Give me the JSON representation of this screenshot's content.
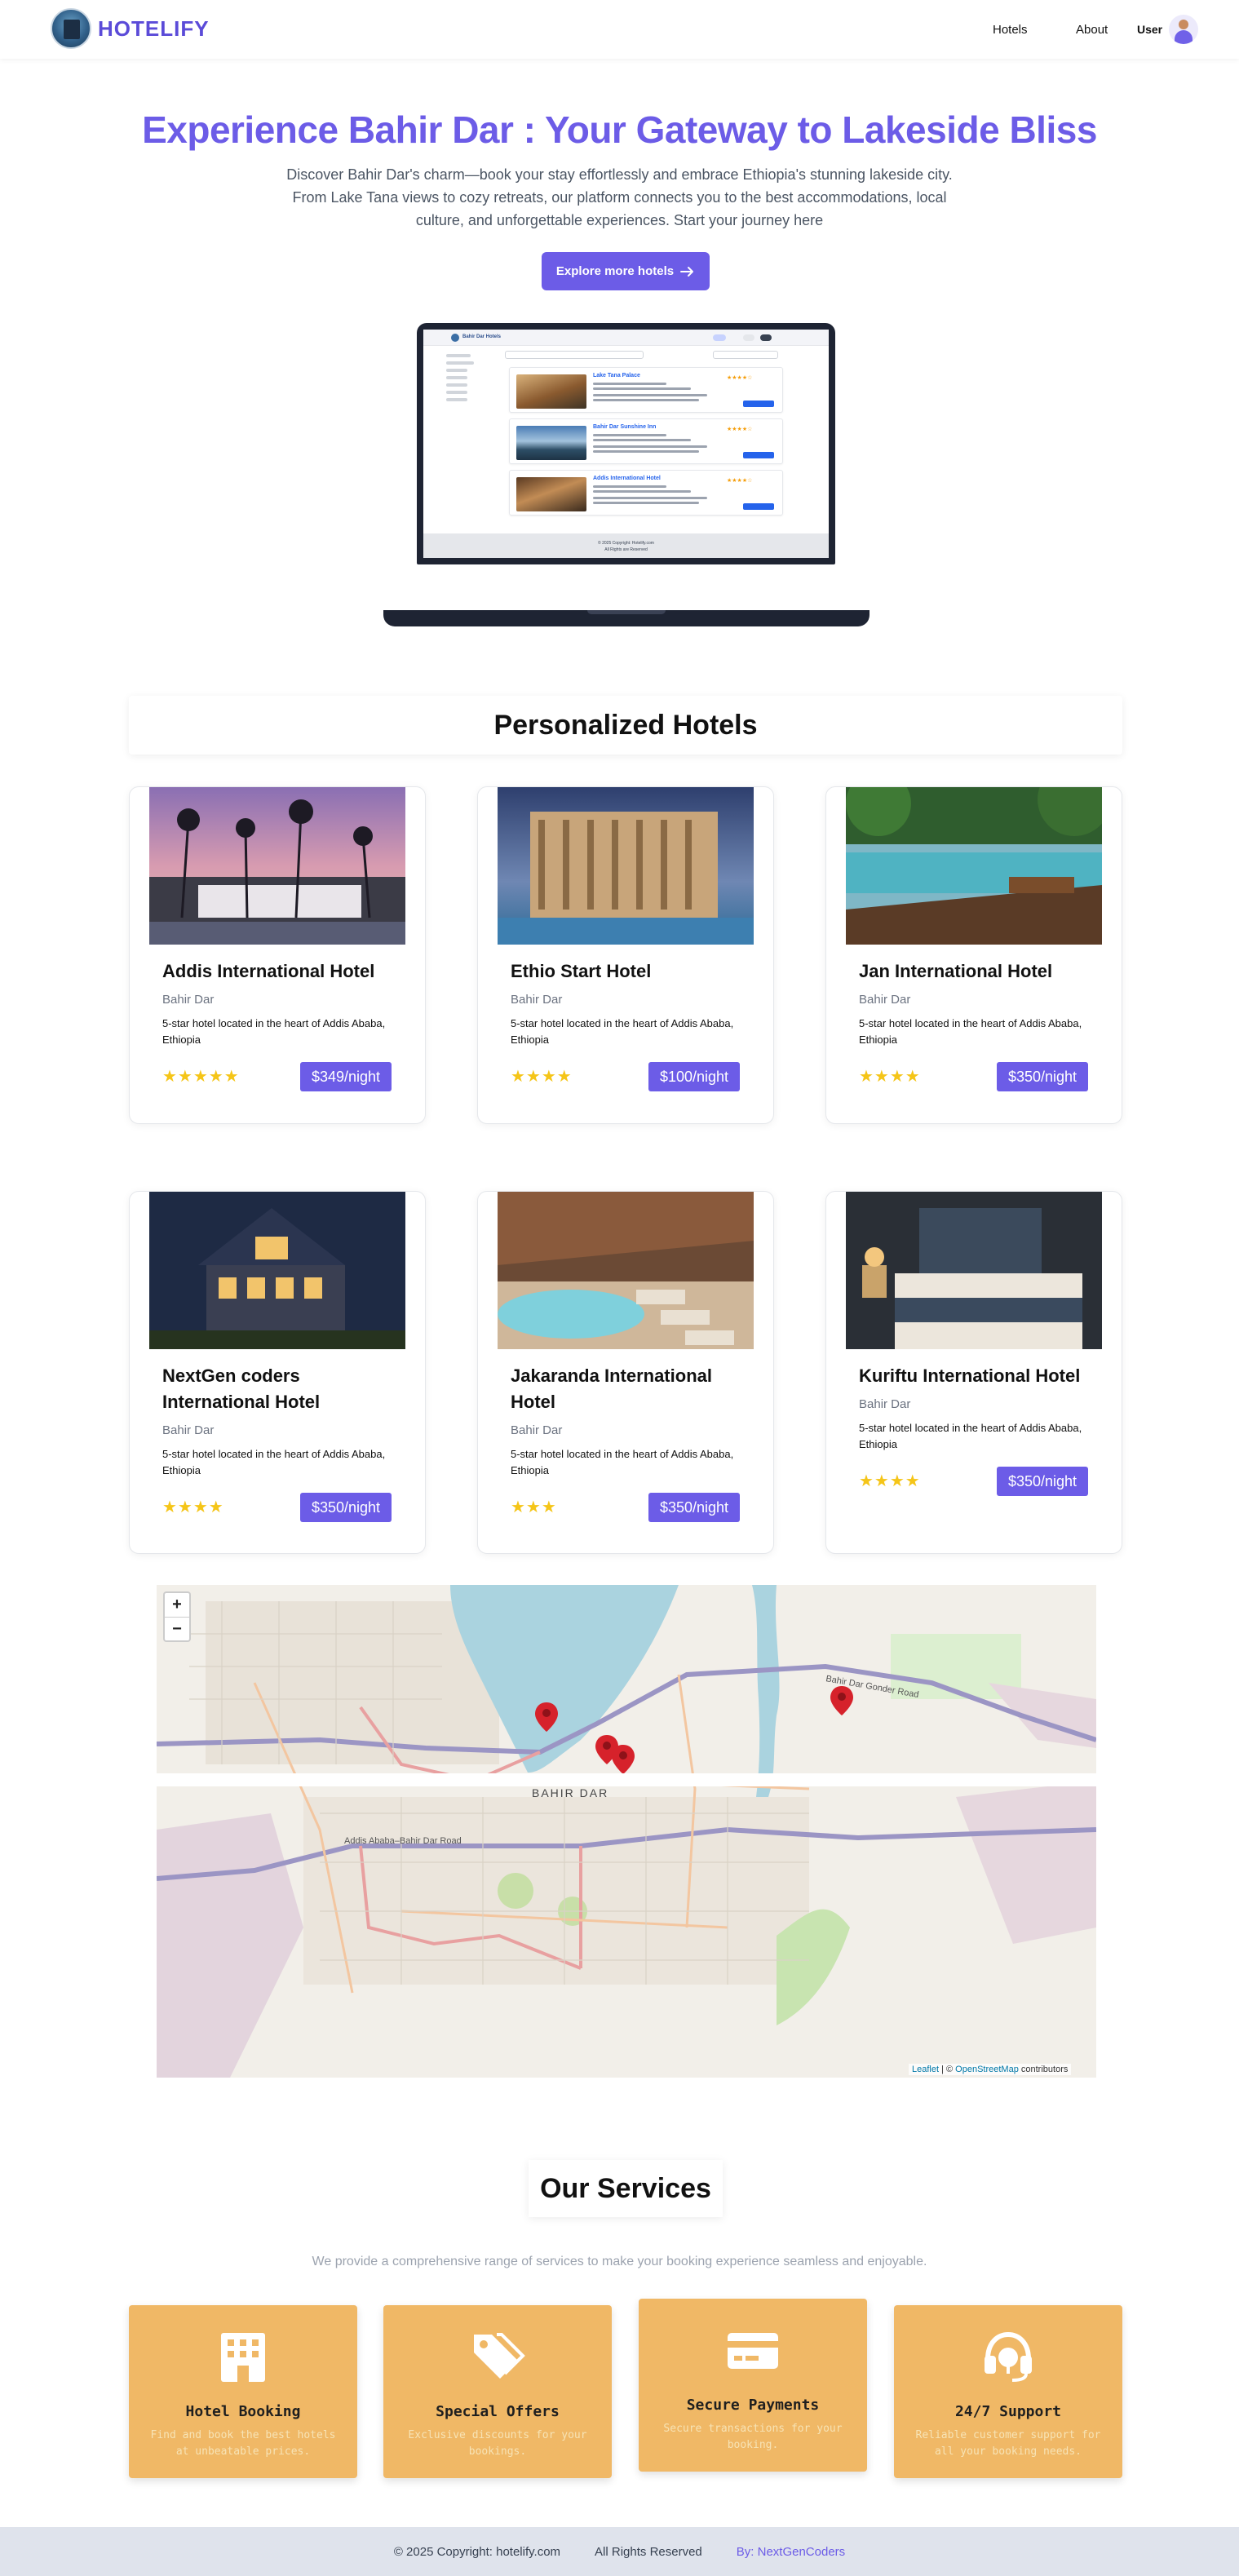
{
  "nav": {
    "brand": "HOTELIFY",
    "links": [
      "Hotels",
      "About"
    ],
    "user_label": "User"
  },
  "hero": {
    "title": "Experience Bahir Dar : Your Gateway to Lakeside Bliss",
    "description": "Discover Bahir Dar's charm—book your stay effortlessly and embrace Ethiopia's stunning lakeside city. From Lake Tana views to cozy retreats, our platform connects you to the best accommodations, local culture, and unforgettable experiences. Start your journey here",
    "button_label": "Explore more hotels",
    "button_icon": "arrow-right-icon"
  },
  "preview": {
    "card_titles": [
      "Lake Tana Palace",
      "Bahir Dar Sunshine Inn",
      "Addis International Hotel"
    ],
    "footer_line1": "© 2025 Copyright: Hotelify.com",
    "footer_line2": "All Rights are Reserved"
  },
  "personalized": {
    "title": "Personalized Hotels",
    "hotels": [
      {
        "name": "Addis International Hotel",
        "location": "Bahir Dar",
        "description": "5-star hotel located in the heart of Addis Ababa, Ethiopia",
        "stars": "★★★★★",
        "price": "$349/night"
      },
      {
        "name": "Ethio Start Hotel",
        "location": "Bahir Dar",
        "description": "5-star hotel located in the heart of Addis Ababa, Ethiopia",
        "stars": "★★★★",
        "price": "$100/night"
      },
      {
        "name": "Jan International Hotel",
        "location": "Bahir Dar",
        "description": "5-star hotel located in the heart of Addis Ababa, Ethiopia",
        "stars": "★★★★",
        "price": "$350/night"
      },
      {
        "name": "NextGen coders International Hotel",
        "location": "Bahir Dar",
        "description": "5-star hotel located in the heart of Addis Ababa, Ethiopia",
        "stars": "★★★★",
        "price": "$350/night"
      },
      {
        "name": "Jakaranda International Hotel",
        "location": "Bahir Dar",
        "description": "5-star hotel located in the heart of Addis Ababa, Ethiopia",
        "stars": "★★★",
        "price": "$350/night"
      },
      {
        "name": "Kuriftu International Hotel",
        "location": "Bahir Dar",
        "description": "5-star hotel located in the heart of Addis Ababa, Ethiopia",
        "stars": "★★★★",
        "price": "$350/night"
      }
    ]
  },
  "map": {
    "zoom_in": "+",
    "zoom_out": "−",
    "city_label": "BAHIR DAR",
    "road_label": "Bahir Dar Gonder Road",
    "road_label2": "Addis Ababa–Bahir Dar Road",
    "attribution_leaflet": "Leaflet",
    "attribution_sep": " | © ",
    "attribution_osm": "OpenStreetMap",
    "attribution_tail": " contributors"
  },
  "services": {
    "title": "Our Services",
    "subtitle": "We provide a comprehensive range of services to make your booking experience seamless and enjoyable.",
    "items": [
      {
        "name": "Hotel Booking",
        "description": "Find and book the best hotels at unbeatable prices.",
        "icon": "building-icon"
      },
      {
        "name": "Special Offers",
        "description": "Exclusive discounts for your bookings.",
        "icon": "tag-icon"
      },
      {
        "name": "Secure Payments",
        "description": "Secure transactions for your booking.",
        "icon": "credit-card-icon"
      },
      {
        "name": "24/7 Support",
        "description": "Reliable customer support for all your booking needs.",
        "icon": "headset-icon"
      }
    ]
  },
  "footer": {
    "copyright": "© 2025 Copyright: hotelify.com",
    "rights": "All Rights Reserved",
    "by": "By: NextGenCoders"
  },
  "colors": {
    "accent": "#6c5ce7",
    "service_card": "#f0b866",
    "star": "#f5c518",
    "footer_bg": "#dfe3ec"
  }
}
